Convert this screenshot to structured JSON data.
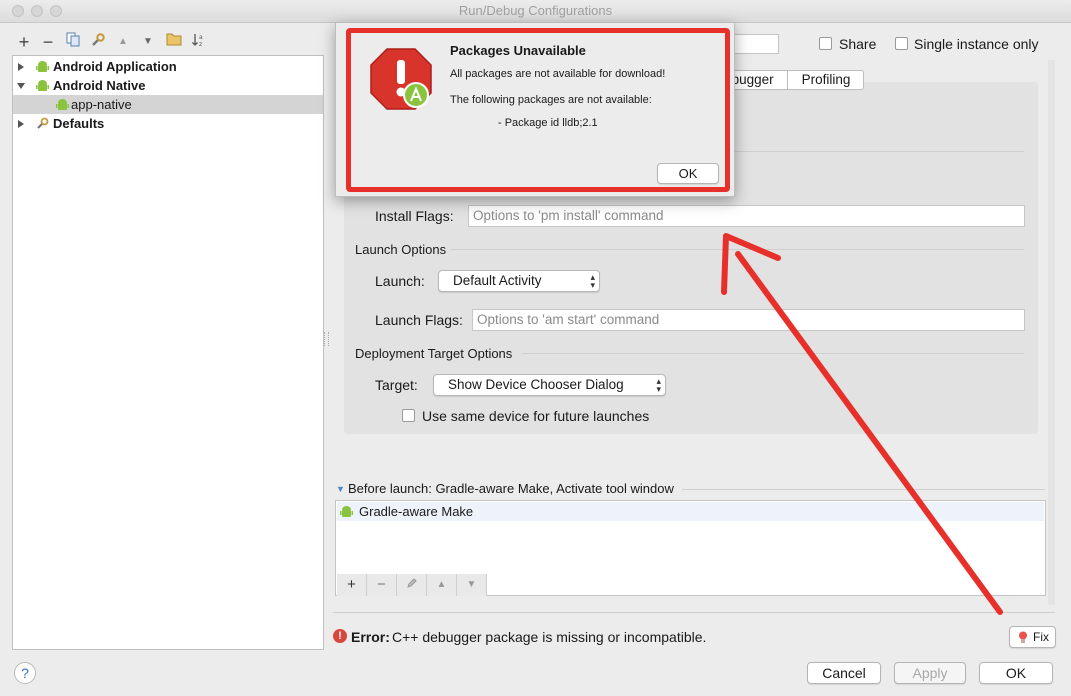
{
  "window": {
    "title": "Run/Debug Configurations"
  },
  "left_toolbar": {
    "add": "+",
    "remove": "−",
    "copy_icon": "copy-icon",
    "wrench_icon": "wrench-icon",
    "up": "▲",
    "down": "▼",
    "folder_icon": "folder-icon",
    "sort_icon": "sort-az-icon"
  },
  "tree": {
    "items": [
      {
        "label": "Android Application",
        "bold": true,
        "expanded": false
      },
      {
        "label": "Android Native",
        "bold": true,
        "expanded": true
      },
      {
        "label": "app-native",
        "bold": false,
        "selected": true
      },
      {
        "label": "Defaults",
        "bold": true,
        "expanded": false
      }
    ]
  },
  "header": {
    "share_label": "Share",
    "single_instance_label": "Single instance only"
  },
  "tabs": {
    "debugger": "Debugger",
    "profiling": "Profiling"
  },
  "general": {
    "install_flags_label": "Install Flags:",
    "install_flags_placeholder": "Options to 'pm install' command",
    "launch_options_title": "Launch Options",
    "launch_label": "Launch:",
    "launch_value": "Default Activity",
    "launch_flags_label": "Launch Flags:",
    "launch_flags_placeholder": "Options to 'am start' command",
    "deployment_title": "Deployment Target Options",
    "target_label": "Target:",
    "target_value": "Show Device Chooser Dialog",
    "same_device_label": "Use same device for future launches"
  },
  "before_launch": {
    "title": "Before launch: Gradle-aware Make, Activate tool window",
    "items": [
      "Gradle-aware Make"
    ],
    "tools": {
      "add": "+",
      "remove": "−",
      "edit_icon": "pencil-icon",
      "up": "▲",
      "down": "▼"
    }
  },
  "error": {
    "prefix": "Error:",
    "message": "C++ debugger package is missing or incompatible.",
    "fix_label": "Fix"
  },
  "footer": {
    "help": "?",
    "cancel": "Cancel",
    "apply": "Apply",
    "ok": "OK"
  },
  "dialog": {
    "title": "Packages Unavailable",
    "line1": "All packages are not available for download!",
    "line2": "The following packages are not available:",
    "line3": "- Package id lldb;2.1",
    "ok": "OK"
  },
  "colors": {
    "annotation_red": "#e8302a",
    "android_green": "#8ac43f",
    "error_red": "#d9463a"
  }
}
